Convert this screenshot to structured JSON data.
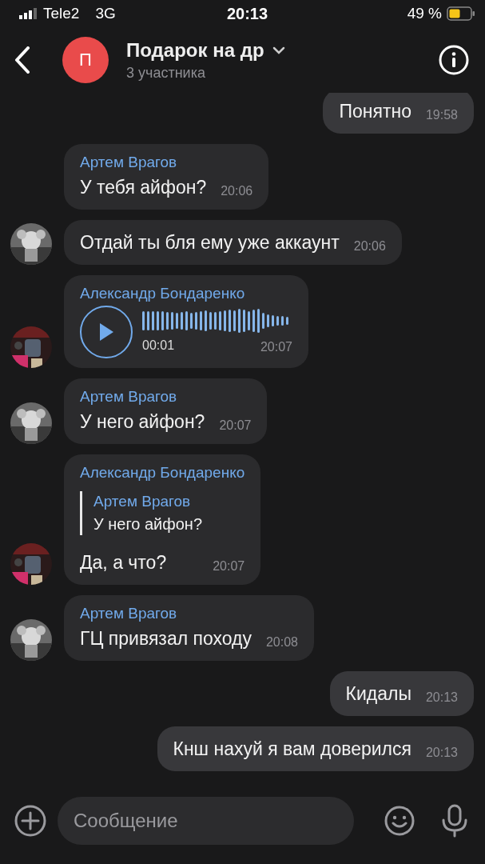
{
  "status_bar": {
    "carrier": "Tele2",
    "network": "3G",
    "time": "20:13",
    "battery": "49 %"
  },
  "header": {
    "avatar_letter": "П",
    "title": "Подарок на др",
    "subtitle": "3 участника"
  },
  "messages": [
    {
      "kind": "text",
      "outgoing": true,
      "text": "Понятно",
      "time": "19:58"
    },
    {
      "kind": "text",
      "outgoing": false,
      "sender": "Артем Врагов",
      "text": "У тебя айфон?",
      "time": "20:06"
    },
    {
      "kind": "text",
      "outgoing": false,
      "text": "Отдай ты бля ему уже аккаунт",
      "time": "20:06"
    },
    {
      "kind": "voice",
      "outgoing": false,
      "sender": "Александр Бондаренко",
      "duration": "00:01",
      "time": "20:07"
    },
    {
      "kind": "text",
      "outgoing": false,
      "sender": "Артем Врагов",
      "text": "У него айфон?",
      "time": "20:07"
    },
    {
      "kind": "reply",
      "outgoing": false,
      "sender": "Александр Бондаренко",
      "quote_sender": "Артем Врагов",
      "quote_text": "У него айфон?",
      "text": "Да, а что?",
      "time": "20:07"
    },
    {
      "kind": "text",
      "outgoing": false,
      "sender": "Артем Врагов",
      "text": "ГЦ привязал походу",
      "time": "20:08"
    },
    {
      "kind": "text",
      "outgoing": true,
      "text": "Кидалы",
      "time": "20:13"
    },
    {
      "kind": "text",
      "outgoing": true,
      "text": "Кнш нахуй я вам доверился",
      "time": "20:13"
    }
  ],
  "composer": {
    "placeholder": "Сообщение"
  }
}
